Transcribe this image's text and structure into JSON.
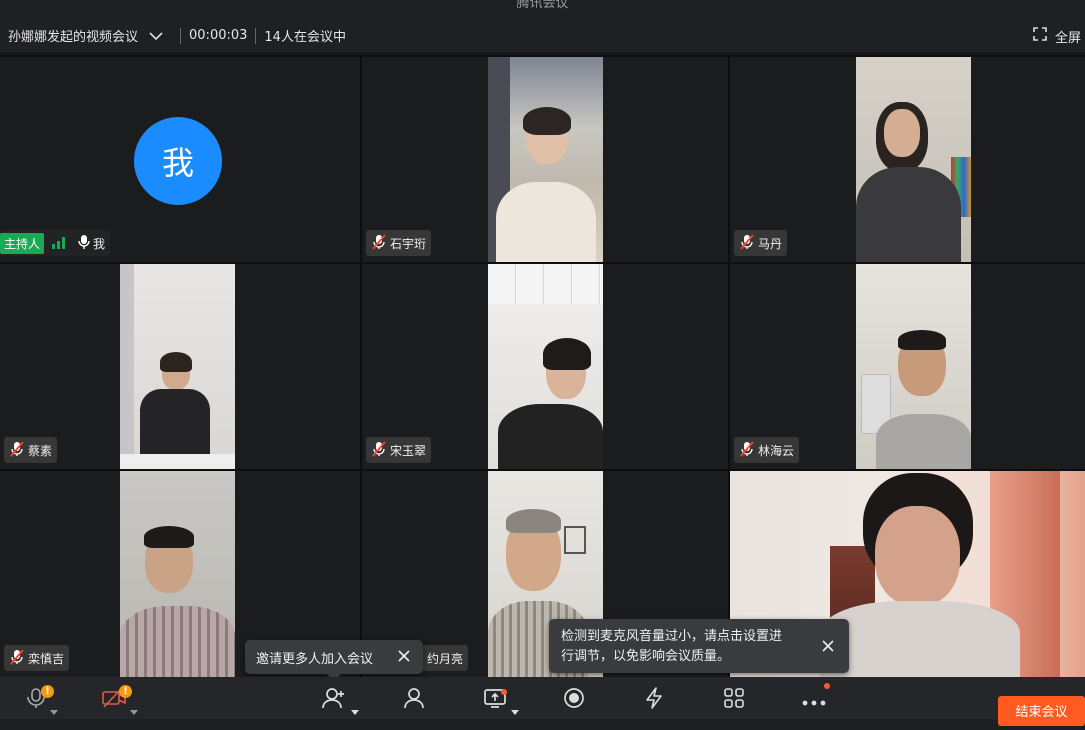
{
  "window": {
    "title": "腾讯会议"
  },
  "header": {
    "meeting_title": "孙娜娜发起的视频会议",
    "timer": "00:00:03",
    "participant_count": "14人在会议中",
    "fullscreen_label": "全屏"
  },
  "tiles": [
    {
      "name": "我",
      "host_label": "主持人",
      "avatar_text": "我"
    },
    {
      "name": "石宇珩"
    },
    {
      "name": "马丹"
    },
    {
      "name": "蔡素"
    },
    {
      "name": "宋玉翠"
    },
    {
      "name": "林海云"
    },
    {
      "name": "栾慎吉"
    },
    {
      "name": "约月亮"
    },
    {
      "name": ""
    }
  ],
  "tooltips": {
    "invite": "邀请更多人加入会议",
    "mic_warning_line1": "检测到麦克风音量过小，请点击设置进",
    "mic_warning_line2": "行调节，以免影响会议质量。"
  },
  "toolbar": {
    "end_meeting_label": "结束会议",
    "warning_badge": "!"
  },
  "colors": {
    "accent": "#1a8cff",
    "host_badge": "#1aaa55",
    "end_button": "#ff5a1f",
    "warning": "#f39c12"
  }
}
